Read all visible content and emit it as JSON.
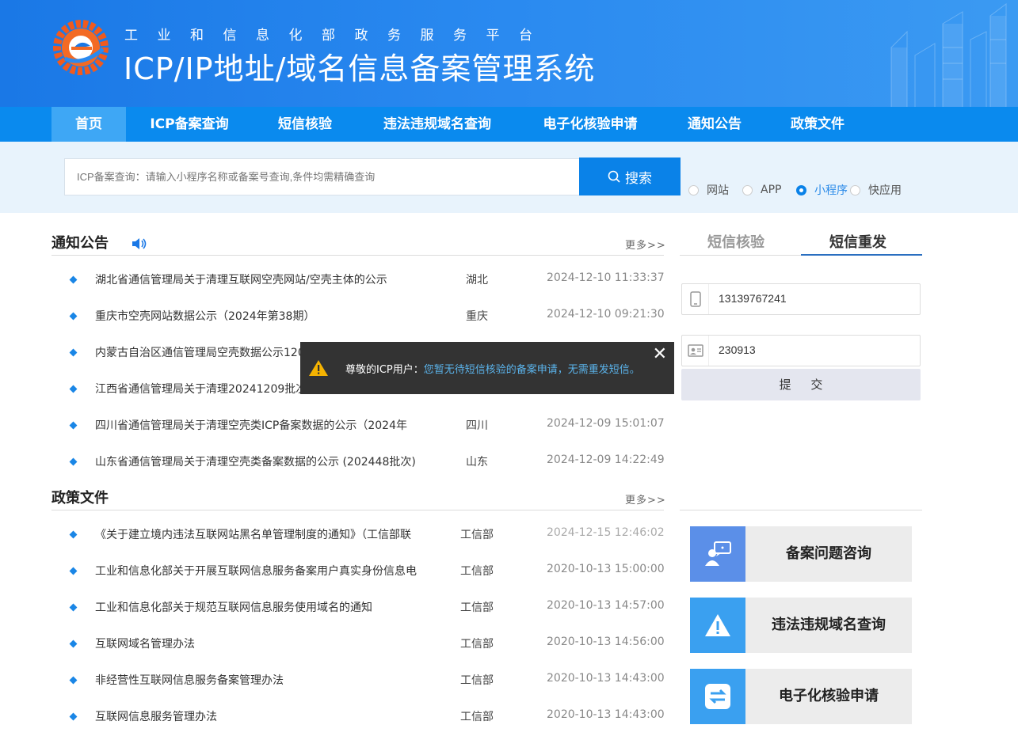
{
  "header": {
    "subtitle": "工业和信息化部政务服务平台",
    "title": "ICP/IP地址/域名信息备案管理系统"
  },
  "nav": [
    "首页",
    "ICP备案查询",
    "短信核验",
    "违法违规域名查询",
    "电子化核验申请",
    "通知公告",
    "政策文件"
  ],
  "search": {
    "placeholder": "ICP备案查询：请输入小程序名称或备案号查询,条件均需精确查询",
    "button": "搜索",
    "types": [
      "网站",
      "APP",
      "小程序",
      "快应用"
    ],
    "selected": "小程序"
  },
  "notices": {
    "title": "通知公告",
    "more": "更多>>",
    "items": [
      {
        "title": "湖北省通信管理局关于清理互联网空壳网站/空壳主体的公示",
        "province": "湖北",
        "date": "2024-12-10 11:33:37"
      },
      {
        "title": "重庆市空壳网站数据公示（2024年第38期）",
        "province": "重庆",
        "date": "2024-12-10 09:21:30"
      },
      {
        "title": "内蒙古自治区通信管理局空壳数据公示120",
        "province": "",
        "date": ""
      },
      {
        "title": "江西省通信管理局关于清理20241209批次",
        "province": "",
        "date": ""
      },
      {
        "title": "四川省通信管理局关于清理空壳类ICP备案数据的公示（2024年",
        "province": "四川",
        "date": "2024-12-09 15:01:07"
      },
      {
        "title": "山东省通信管理局关于清理空壳类备案数据的公示 (202448批次)",
        "province": "山东",
        "date": "2024-12-09 14:22:49"
      }
    ]
  },
  "policies": {
    "title": "政策文件",
    "more": "更多>>",
    "items": [
      {
        "title": "《关于建立境内违法互联网站黑名单管理制度的通知》（工信部联",
        "source": "工信部",
        "date": "2024-12-15 12:46:02"
      },
      {
        "title": "工业和信息化部关于开展互联网信息服务备案用户真实身份信息电",
        "source": "工信部",
        "date": "2020-10-13 15:00:00"
      },
      {
        "title": "工业和信息化部关于规范互联网信息服务使用域名的通知",
        "source": "工信部",
        "date": "2020-10-13 14:57:00"
      },
      {
        "title": "互联网域名管理办法",
        "source": "工信部",
        "date": "2020-10-13 14:56:00"
      },
      {
        "title": "非经营性互联网信息服务备案管理办法",
        "source": "工信部",
        "date": "2020-10-13 14:43:00"
      },
      {
        "title": "互联网信息服务管理办法",
        "source": "工信部",
        "date": "2020-10-13 14:43:00"
      }
    ]
  },
  "sms": {
    "tabs": [
      "短信核验",
      "短信重发"
    ],
    "active_tab": "短信重发",
    "phone": "13139767241",
    "id_value": "230913",
    "submit": "提 交"
  },
  "cards": [
    {
      "label": "备案问题咨询",
      "icon": "consult-icon",
      "color": "#5b8fe8"
    },
    {
      "label": "违法违规域名查询",
      "icon": "warning-icon",
      "color": "#3aa0f0"
    },
    {
      "label": "电子化核验申请",
      "icon": "exchange-icon",
      "color": "#3aa0f0"
    }
  ],
  "toast": {
    "label": "尊敬的ICP用户：",
    "message": "您暂无待短信核验的备案申请，无需重发短信。"
  }
}
